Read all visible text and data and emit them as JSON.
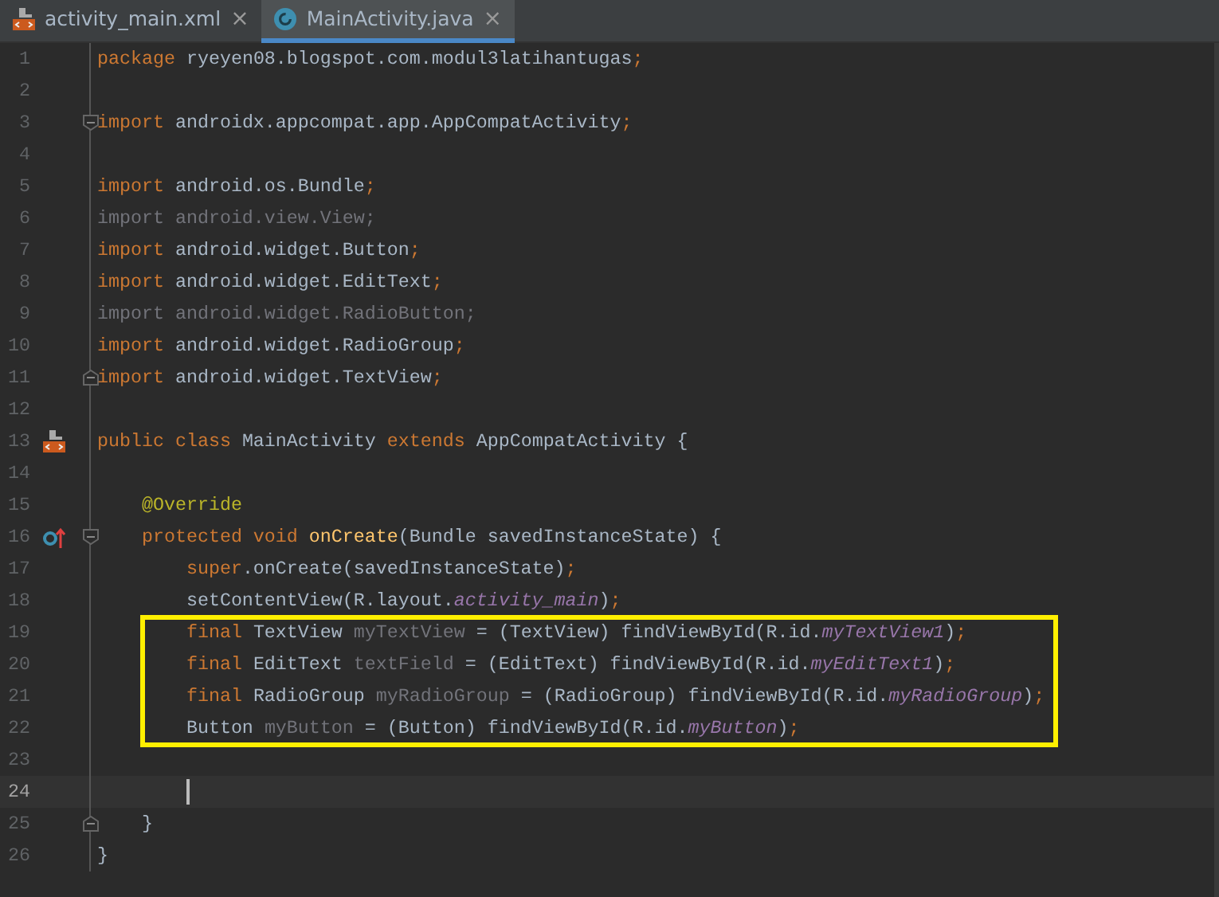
{
  "tabs": [
    {
      "label": "activity_main.xml",
      "kind": "xml",
      "selected": false,
      "close": "×"
    },
    {
      "label": "MainActivity.java",
      "kind": "class",
      "selected": true,
      "close": "×"
    }
  ],
  "lines": [
    {
      "number": "1",
      "current": false,
      "boxed": false,
      "tokens": [
        {
          "kind": "kw",
          "text": "package "
        },
        {
          "kind": "plain",
          "text": "ryeyen08.blogspot.com.modul3latihantugas"
        },
        {
          "kind": "kw",
          "text": ";"
        }
      ]
    },
    {
      "number": "2",
      "current": false,
      "boxed": false
    },
    {
      "number": "3",
      "current": false,
      "boxed": false,
      "fold_marker": {
        "kind": "open"
      },
      "tokens": [
        {
          "kind": "kw",
          "text": "import "
        },
        {
          "kind": "plain",
          "text": "androidx.appcompat.app.AppCompatActivity"
        },
        {
          "kind": "kw",
          "text": ";"
        }
      ]
    },
    {
      "number": "4",
      "current": false,
      "boxed": false
    },
    {
      "number": "5",
      "current": false,
      "boxed": false,
      "tokens": [
        {
          "kind": "kw",
          "text": "import "
        },
        {
          "kind": "plain",
          "text": "android.os.Bundle"
        },
        {
          "kind": "kw",
          "text": ";"
        }
      ]
    },
    {
      "number": "6",
      "current": false,
      "boxed": false,
      "tokens": [
        {
          "kind": "unused",
          "text": "import android.view.View;"
        }
      ]
    },
    {
      "number": "7",
      "current": false,
      "boxed": false,
      "tokens": [
        {
          "kind": "kw",
          "text": "import "
        },
        {
          "kind": "plain",
          "text": "android.widget.Button"
        },
        {
          "kind": "kw",
          "text": ";"
        }
      ]
    },
    {
      "number": "8",
      "current": false,
      "boxed": false,
      "tokens": [
        {
          "kind": "kw",
          "text": "import "
        },
        {
          "kind": "plain",
          "text": "android.widget.EditText"
        },
        {
          "kind": "kw",
          "text": ";"
        }
      ]
    },
    {
      "number": "9",
      "current": false,
      "boxed": false,
      "tokens": [
        {
          "kind": "unused",
          "text": "import android.widget.RadioButton;"
        }
      ]
    },
    {
      "number": "10",
      "current": false,
      "boxed": false,
      "tokens": [
        {
          "kind": "kw",
          "text": "import "
        },
        {
          "kind": "plain",
          "text": "android.widget.RadioGroup"
        },
        {
          "kind": "kw",
          "text": ";"
        }
      ]
    },
    {
      "number": "11",
      "current": false,
      "boxed": false,
      "fold_marker": {
        "kind": "close"
      },
      "tokens": [
        {
          "kind": "kw",
          "text": "import "
        },
        {
          "kind": "plain",
          "text": "android.widget.TextView"
        },
        {
          "kind": "kw",
          "text": ";"
        }
      ]
    },
    {
      "number": "12",
      "current": false,
      "boxed": false
    },
    {
      "number": "13",
      "current": false,
      "boxed": false,
      "gutter_icon": {
        "kind": "layout"
      },
      "tokens": [
        {
          "kind": "kw",
          "text": "public class "
        },
        {
          "kind": "plain",
          "text": "MainActivity "
        },
        {
          "kind": "kw",
          "text": "extends "
        },
        {
          "kind": "plain",
          "text": "AppCompatActivity {"
        }
      ]
    },
    {
      "number": "14",
      "current": false,
      "boxed": false
    },
    {
      "number": "15",
      "current": false,
      "boxed": false,
      "tokens": [
        {
          "kind": "annotation",
          "text": "    @Override"
        }
      ]
    },
    {
      "number": "16",
      "current": false,
      "boxed": false,
      "gutter_icon": {
        "kind": "override"
      },
      "fold_marker": {
        "kind": "open"
      },
      "tokens": [
        {
          "kind": "kw",
          "text": "    protected void "
        },
        {
          "kind": "method",
          "text": "onCreate"
        },
        {
          "kind": "plain",
          "text": "(Bundle savedInstanceState) {"
        }
      ]
    },
    {
      "number": "17",
      "current": false,
      "boxed": false,
      "tokens": [
        {
          "kind": "kw",
          "text": "        super"
        },
        {
          "kind": "plain",
          "text": ".onCreate(savedInstanceState)"
        },
        {
          "kind": "kw",
          "text": ";"
        }
      ]
    },
    {
      "number": "18",
      "current": false,
      "boxed": false,
      "tokens": [
        {
          "kind": "plain",
          "text": "        setContentView(R.layout."
        },
        {
          "kind": "field",
          "text": "activity_main"
        },
        {
          "kind": "plain",
          "text": ")"
        },
        {
          "kind": "kw",
          "text": ";"
        }
      ]
    },
    {
      "number": "19",
      "current": false,
      "boxed": true,
      "tokens": [
        {
          "kind": "kw",
          "text": "        final "
        },
        {
          "kind": "plain",
          "text": "TextView "
        },
        {
          "kind": "unused",
          "text": "myTextView"
        },
        {
          "kind": "plain",
          "text": " = (TextView) findViewById(R.id."
        },
        {
          "kind": "field",
          "text": "myTextView1"
        },
        {
          "kind": "plain",
          "text": ")"
        },
        {
          "kind": "kw",
          "text": ";"
        }
      ]
    },
    {
      "number": "20",
      "current": false,
      "boxed": true,
      "tokens": [
        {
          "kind": "kw",
          "text": "        final "
        },
        {
          "kind": "plain",
          "text": "EditText "
        },
        {
          "kind": "unused",
          "text": "textField"
        },
        {
          "kind": "plain",
          "text": " = (EditText) findViewById(R.id."
        },
        {
          "kind": "field",
          "text": "myEditText1"
        },
        {
          "kind": "plain",
          "text": ")"
        },
        {
          "kind": "kw",
          "text": ";"
        }
      ]
    },
    {
      "number": "21",
      "current": false,
      "boxed": true,
      "tokens": [
        {
          "kind": "kw",
          "text": "        final "
        },
        {
          "kind": "plain",
          "text": "RadioGroup "
        },
        {
          "kind": "unused",
          "text": "myRadioGroup"
        },
        {
          "kind": "plain",
          "text": " = (RadioGroup) findViewById(R.id."
        },
        {
          "kind": "field",
          "text": "myRadioGroup"
        },
        {
          "kind": "plain",
          "text": ")"
        },
        {
          "kind": "kw",
          "text": ";"
        }
      ]
    },
    {
      "number": "22",
      "current": false,
      "boxed": true,
      "tokens": [
        {
          "kind": "plain",
          "text": "        Button "
        },
        {
          "kind": "unused",
          "text": "myButton"
        },
        {
          "kind": "plain",
          "text": " = (Button) findViewById(R.id."
        },
        {
          "kind": "field",
          "text": "myButton"
        },
        {
          "kind": "plain",
          "text": ")"
        },
        {
          "kind": "kw",
          "text": ";"
        }
      ]
    },
    {
      "number": "23",
      "current": false,
      "boxed": false
    },
    {
      "number": "24",
      "current": true,
      "boxed": false
    },
    {
      "number": "25",
      "current": false,
      "boxed": false,
      "fold_marker": {
        "kind": "close"
      },
      "tokens": [
        {
          "kind": "plain",
          "text": "    }"
        }
      ]
    },
    {
      "number": "26",
      "current": false,
      "boxed": false,
      "tokens": [
        {
          "kind": "plain",
          "text": "}"
        }
      ]
    }
  ]
}
